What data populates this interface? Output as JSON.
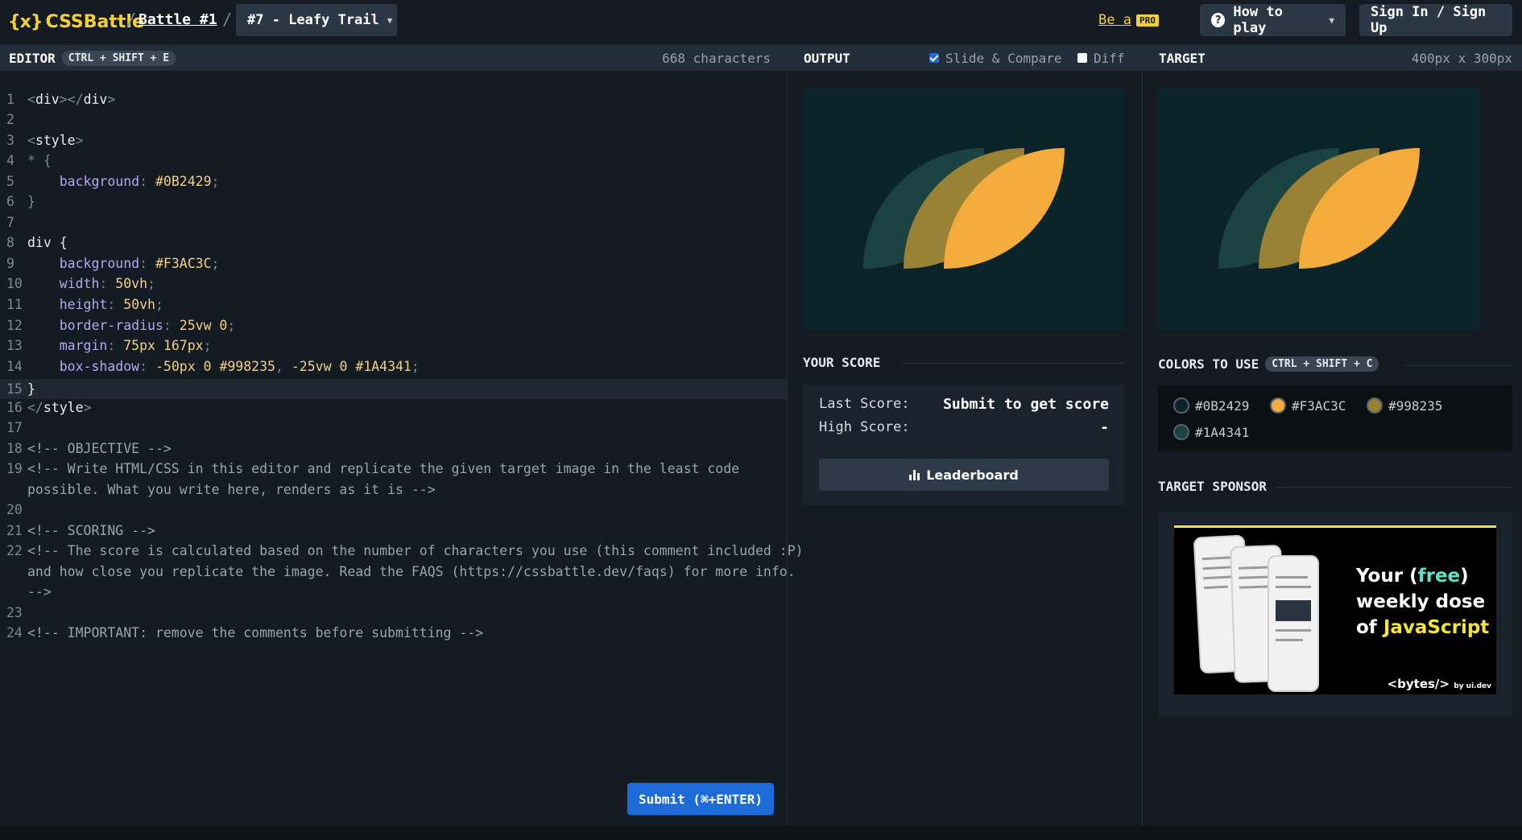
{
  "header": {
    "logo_mark": "{x}",
    "logo_text": "CSSBattle",
    "battle_link": "Battle #1",
    "battle_select": "#7 - Leafy Trail",
    "be_a": "Be a",
    "pro": "PRO",
    "how_to_play": "How to play",
    "sign_in": "Sign In / Sign Up"
  },
  "editor": {
    "title": "EDITOR",
    "shortcut": "CTRL + SHIFT + E",
    "char_count": "668 characters",
    "lines": {
      "n1": "1",
      "n2": "2",
      "n3": "3",
      "n4": "4",
      "n5": "5",
      "n6": "6",
      "n7": "7",
      "n8": "8",
      "n9": "9",
      "n10": "10",
      "n11": "11",
      "n12": "12",
      "n13": "13",
      "n14": "14",
      "n15": "15",
      "n16": "16",
      "n17": "17",
      "n18": "18",
      "n19": "19",
      "n20": "20",
      "n21": "21",
      "n22": "22",
      "n23": "23",
      "n24": "24"
    },
    "code": {
      "l1_open": "<div>",
      "l1_close": "</div>",
      "l3": "<style>",
      "l4": "* {",
      "l5_prop": "background",
      "l5_val": "#0B2429",
      "l6": "}",
      "l8": "div {",
      "l9_prop": "background",
      "l9_val": "#F3AC3C",
      "l10_prop": "width",
      "l10_val": "50vh",
      "l11_prop": "height",
      "l11_val": "50vh",
      "l12_prop": "border-radius",
      "l12_val": "25vw 0",
      "l13_prop": "margin",
      "l13_val": "75px 167px",
      "l14_prop": "box-shadow",
      "l14_val1": "-50px 0 #998235",
      "l14_val2": "-25vw 0 #1A4341",
      "l15": "}",
      "l16": "</style>",
      "l18": "<!-- OBJECTIVE -->",
      "l19a": "<!-- Write HTML/CSS in this editor and replicate the given target image in the least code",
      "l19b": "possible. What you write here, renders as it is -->",
      "l21": "<!-- SCORING -->",
      "l22a": "<!-- The score is calculated based on the number of characters you use (this comment included :P)",
      "l22b": "and how close you replicate the image. Read the FAQS (https://cssbattle.dev/faqs) for more info.",
      "l22c": "-->",
      "l24": "<!-- IMPORTANT: remove the comments before submitting -->"
    },
    "submit": "Submit (⌘+ENTER)"
  },
  "output": {
    "title": "OUTPUT",
    "slide_compare": "Slide & Compare",
    "diff": "Diff",
    "slide_compare_checked": true,
    "diff_checked": false
  },
  "target": {
    "title": "TARGET",
    "dimensions": "400px x 300px"
  },
  "score": {
    "title": "YOUR SCORE",
    "last_label": "Last Score:",
    "last_value": "Submit to get score",
    "high_label": "High Score:",
    "high_value": "-",
    "leaderboard": "Leaderboard"
  },
  "colors": {
    "title": "COLORS TO USE",
    "shortcut": "CTRL + SHIFT + C",
    "items": [
      {
        "hex": "#0B2429",
        "label": "#0B2429"
      },
      {
        "hex": "#F3AC3C",
        "label": "#F3AC3C"
      },
      {
        "hex": "#998235",
        "label": "#998235"
      },
      {
        "hex": "#1A4341",
        "label": "#1A4341"
      }
    ]
  },
  "sponsor": {
    "title": "TARGET SPONSOR",
    "ad_line1_a": "Your (",
    "ad_free": "free",
    "ad_line1_b": ")",
    "ad_line2": "weekly dose",
    "ad_line3_a": "of ",
    "ad_js": "JavaScript",
    "ad_brand": "<bytes/>",
    "ad_brand_small": "by ui.dev"
  }
}
